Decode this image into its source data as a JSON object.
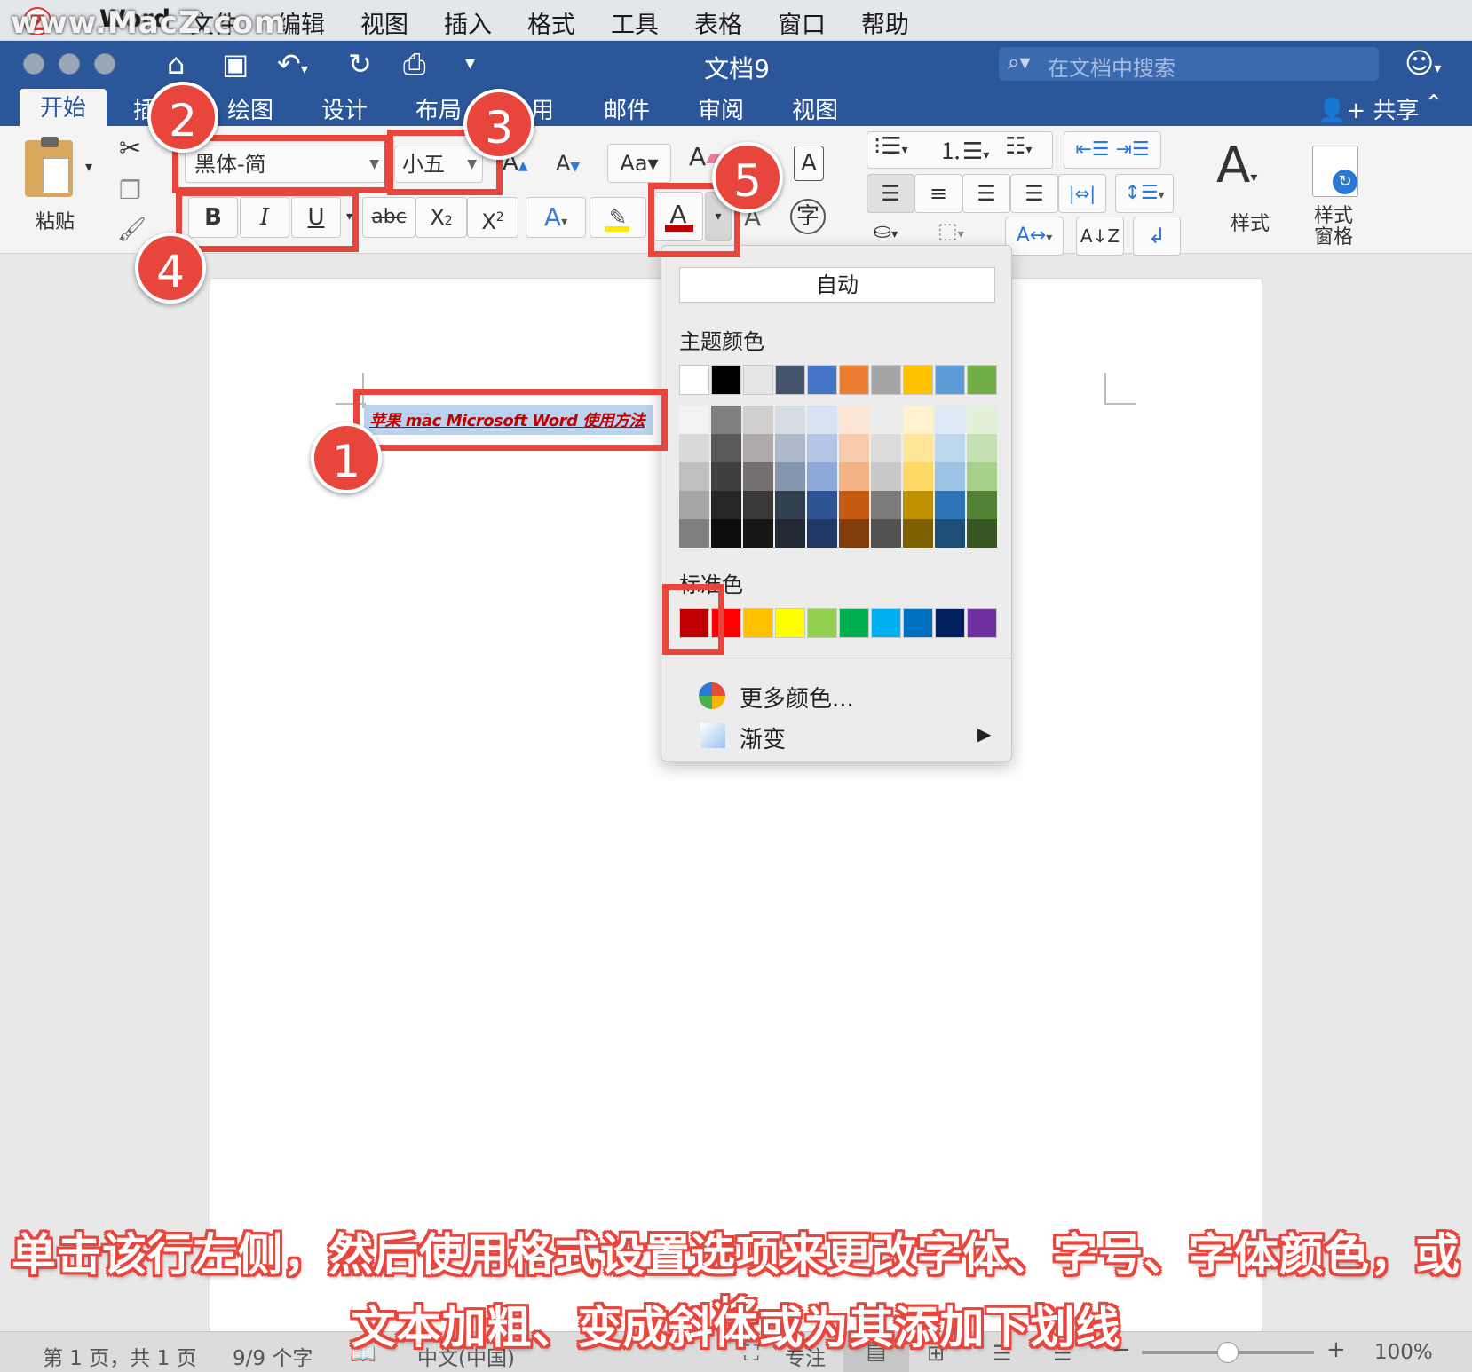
{
  "menubar": {
    "watermark": "www.MacZ.com",
    "logo": "Z",
    "app": "Word",
    "items": [
      "文件",
      "编辑",
      "视图",
      "插入",
      "格式",
      "工具",
      "表格",
      "窗口",
      "帮助"
    ]
  },
  "titlebar": {
    "doc_title": "文档9",
    "search_placeholder": "在文档中搜索",
    "icons": [
      "home-icon",
      "save-icon",
      "undo-icon",
      "redo-icon",
      "print-icon",
      "customize-icon",
      "feedback-smile-icon"
    ]
  },
  "ribbon_tabs": {
    "home": "开始",
    "insert": "插",
    "draw": "绘图",
    "design": "设计",
    "layout": "布局",
    "references": "用",
    "mailings": "邮件",
    "review": "审阅",
    "view": "视图",
    "share": "共享"
  },
  "ribbon": {
    "paste_label": "粘贴",
    "font_name": "黑体-简",
    "font_size": "小五",
    "bold": "B",
    "italic": "I",
    "underline": "U",
    "strike": "abc",
    "styles_label": "样式",
    "styles_pane_label_1": "样式",
    "styles_pane_label_2": "窗格"
  },
  "document": {
    "selected_text": "苹果 mac Microsoft Word  使用方法"
  },
  "color_popup": {
    "auto_label": "自动",
    "theme_label": "主题颜色",
    "standard_label": "标准色",
    "more_colors": "更多颜色...",
    "gradient": "渐变",
    "theme_top": [
      "#ffffff",
      "#000000",
      "#e7e6e6",
      "#44546a",
      "#4472c4",
      "#ed7d31",
      "#a5a5a5",
      "#ffc000",
      "#5b9bd5",
      "#70ad47"
    ],
    "theme_shades": [
      [
        "#f2f2f2",
        "#d9d9d9",
        "#bfbfbf",
        "#a6a6a6",
        "#7f7f7f"
      ],
      [
        "#7f7f7f",
        "#595959",
        "#3f3f3f",
        "#262626",
        "#0d0d0d"
      ],
      [
        "#d0cece",
        "#aeaaaa",
        "#757070",
        "#3b3838",
        "#171616"
      ],
      [
        "#d6dce4",
        "#adb9ca",
        "#8496b0",
        "#323f4f",
        "#222a35"
      ],
      [
        "#d9e2f3",
        "#b4c6e7",
        "#8eaadb",
        "#2f5496",
        "#1f3864"
      ],
      [
        "#fbe5d5",
        "#f7cbac",
        "#f4b183",
        "#c55a11",
        "#833c0b"
      ],
      [
        "#ededed",
        "#dbdbdb",
        "#c9c9c9",
        "#7b7b7b",
        "#525252"
      ],
      [
        "#fff2cc",
        "#ffe598",
        "#ffd965",
        "#bf9000",
        "#7f6000"
      ],
      [
        "#deebf6",
        "#bdd7ee",
        "#9cc2e5",
        "#2e75b5",
        "#1f4e79"
      ],
      [
        "#e2efd9",
        "#c5e0b3",
        "#a8d08d",
        "#538135",
        "#375623"
      ]
    ],
    "standard": [
      "#c00000",
      "#ff0000",
      "#ffc000",
      "#ffff00",
      "#92d050",
      "#00b050",
      "#00b0f0",
      "#0070c0",
      "#002060",
      "#7030a0"
    ]
  },
  "callouts": [
    "1",
    "2",
    "3",
    "4",
    "5"
  ],
  "caption": {
    "line1": "单击该行左侧，然后使用格式设置选项来更改字体、字号、字体颜色，或将",
    "line2": "文本加粗、变成斜体或为其添加下划线"
  },
  "status": {
    "page": "第 1 页，共 1 页",
    "words": "9/9 个字",
    "language": "中文(中国)",
    "focus": "专注",
    "zoom": "100%",
    "zoom_percent": 100
  }
}
